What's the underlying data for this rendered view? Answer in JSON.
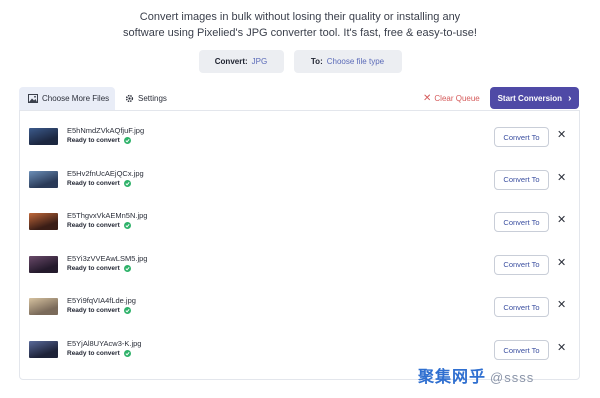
{
  "intro": {
    "line1": "Convert images in bulk without losing their quality or installing any",
    "line2": "software using Pixelied's JPG converter tool. It's fast, free & easy-to-use!"
  },
  "converter": {
    "from_label": "Convert:",
    "from_value": "JPG",
    "to_label": "To:",
    "to_value": "Choose file type"
  },
  "toolbar": {
    "choose_files": "Choose More Files",
    "settings": "Settings",
    "clear_queue": "Clear Queue",
    "start": "Start Conversion"
  },
  "files": [
    {
      "name": "E5hNmdZVkAQfjuF.jpg",
      "status": "Ready to convert",
      "action": "Convert To",
      "thumb_colors": [
        "#1c2740",
        "#3c5b8c"
      ]
    },
    {
      "name": "E5Hv2fnUcAEjQCx.jpg",
      "status": "Ready to convert",
      "action": "Convert To",
      "thumb_colors": [
        "#2a3a58",
        "#6c8fb8"
      ]
    },
    {
      "name": "E5ThgvxVkAEMn5N.jpg",
      "status": "Ready to convert",
      "action": "Convert To",
      "thumb_colors": [
        "#3a1d16",
        "#c0683a"
      ]
    },
    {
      "name": "E5Yi3zVVEAwLSM5.jpg",
      "status": "Ready to convert",
      "action": "Convert To",
      "thumb_colors": [
        "#241a2c",
        "#6a4a6a"
      ]
    },
    {
      "name": "E5Yi9fqVIA4fLde.jpg",
      "status": "Ready to convert",
      "action": "Convert To",
      "thumb_colors": [
        "#7a6a5a",
        "#d6c2a0"
      ]
    },
    {
      "name": "E5YjAl8UYAcw3-K.jpg",
      "status": "Ready to convert",
      "action": "Convert To",
      "thumb_colors": [
        "#1d2238",
        "#5a6a9a"
      ]
    }
  ],
  "watermark": {
    "brand": "聚集网乎",
    "handle": "@ssss"
  },
  "colors": {
    "accent": "#4f4aa6",
    "danger": "#d55a5a",
    "success": "#2fb26a",
    "link": "#5a6ab8"
  }
}
